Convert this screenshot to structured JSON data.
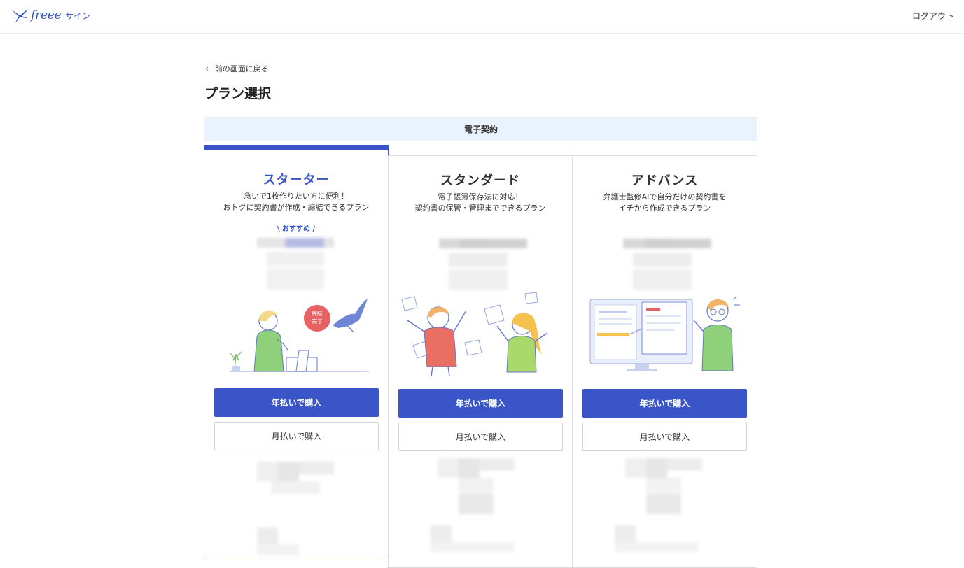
{
  "header": {
    "logo_text": "freee",
    "logo_sub": "サイン",
    "logout_label": "ログアウト"
  },
  "nav": {
    "back_label": "前の画面に戻る"
  },
  "page": {
    "title": "プラン選択",
    "category": "電子契約"
  },
  "plans": [
    {
      "name": "スターター",
      "desc_line1": "急いで1枚作りたい方に便利！",
      "desc_line2": "おトクに契約書が作成・締結できるプラン",
      "badge": "\\ おすすめ /",
      "selected": true,
      "stamp_text": "締結完了",
      "annual_label": "年払いで購入",
      "monthly_label": "月払いで購入"
    },
    {
      "name": "スタンダード",
      "desc_line1": "電子帳簿保存法に対応！",
      "desc_line2": "契約書の保管・管理までできるプラン",
      "annual_label": "年払いで購入",
      "monthly_label": "月払いで購入"
    },
    {
      "name": "アドバンス",
      "desc_line1": "弁護士監修AIで自分だけの契約書を",
      "desc_line2": "イチから作成できるプラン",
      "annual_label": "年払いで購入",
      "monthly_label": "月払いで購入"
    }
  ],
  "colors": {
    "brand": "#3a55c8",
    "category_bg": "#eaf2fd"
  },
  "icons": {
    "logo": "bird-logo-icon",
    "back": "chevron-left-icon"
  }
}
